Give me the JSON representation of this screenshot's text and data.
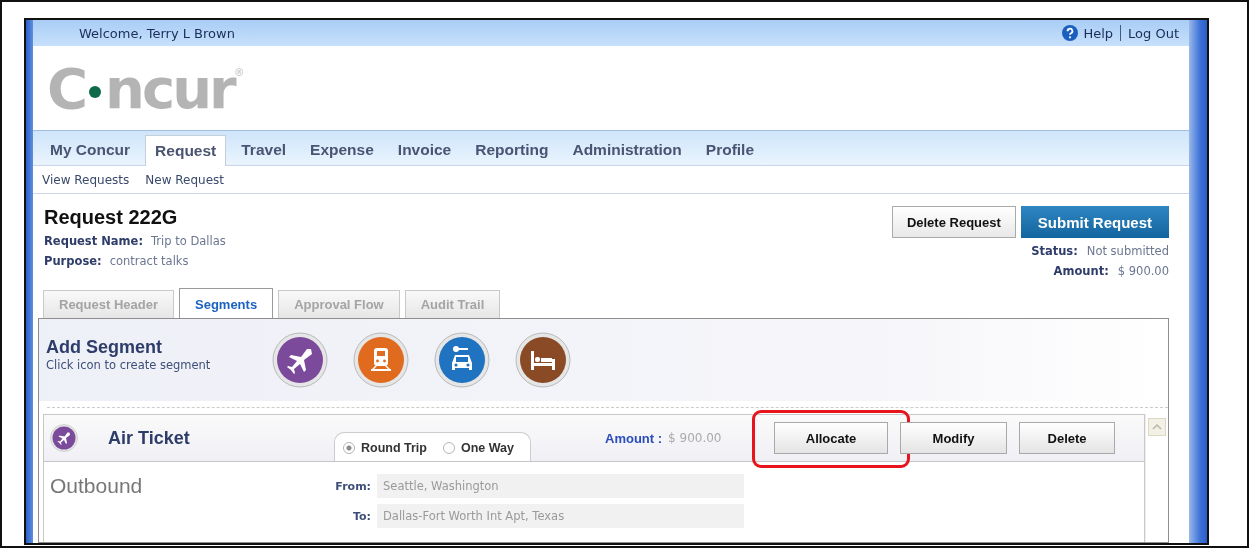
{
  "top_bar": {
    "welcome": "Welcome, Terry L Brown",
    "help": "Help",
    "logout": "Log Out"
  },
  "logo": {
    "before": "C",
    "after": "ncur",
    "mark": "®"
  },
  "nav": [
    {
      "label": "My Concur",
      "selected": false
    },
    {
      "label": "Request",
      "selected": true
    },
    {
      "label": "Travel",
      "selected": false
    },
    {
      "label": "Expense",
      "selected": false
    },
    {
      "label": "Invoice",
      "selected": false
    },
    {
      "label": "Reporting",
      "selected": false
    },
    {
      "label": "Administration",
      "selected": false
    },
    {
      "label": "Profile",
      "selected": false
    }
  ],
  "subnav": [
    "View Requests",
    "New Request"
  ],
  "request": {
    "title": "Request 222G",
    "fields": [
      {
        "label": "Request Name:",
        "value": "Trip to Dallas"
      },
      {
        "label": "Purpose:",
        "value": "contract talks"
      }
    ],
    "buttons": [
      {
        "label": "Delete Request",
        "kind": "secondary"
      },
      {
        "label": "Submit Request",
        "kind": "primary"
      }
    ],
    "summary": [
      {
        "label": "Status:",
        "value": "Not submitted"
      },
      {
        "label": "Amount:",
        "value": "$ 900.00"
      }
    ]
  },
  "tabs": [
    {
      "label": "Request Header",
      "selected": false
    },
    {
      "label": "Segments",
      "selected": true
    },
    {
      "label": "Approval Flow",
      "selected": false
    },
    {
      "label": "Audit Trail",
      "selected": false
    }
  ],
  "add_segment": {
    "title": "Add Segment",
    "hint": "Click icon to create segment",
    "icons": [
      {
        "kind": "plane",
        "color": "#7b4a9a"
      },
      {
        "kind": "train",
        "color": "#e06a1e"
      },
      {
        "kind": "car",
        "color": "#1f73c0"
      },
      {
        "kind": "hotel",
        "color": "#8b4a26"
      }
    ]
  },
  "segment": {
    "title": "Air Ticket",
    "trip_types": [
      {
        "label": "Round Trip",
        "selected": true
      },
      {
        "label": "One Way",
        "selected": false
      }
    ],
    "amount_label": "Amount :",
    "amount": "$ 900.00",
    "buttons": [
      {
        "label": "Allocate",
        "highlighted": true
      },
      {
        "label": "Modify",
        "highlighted": false
      },
      {
        "label": "Delete",
        "highlighted": false
      }
    ],
    "section": "Outbound",
    "fields": [
      {
        "label": "From:",
        "value": "Seattle, Washington"
      },
      {
        "label": "To:",
        "value": "Dallas-Fort Worth Int Apt, Texas"
      }
    ]
  }
}
